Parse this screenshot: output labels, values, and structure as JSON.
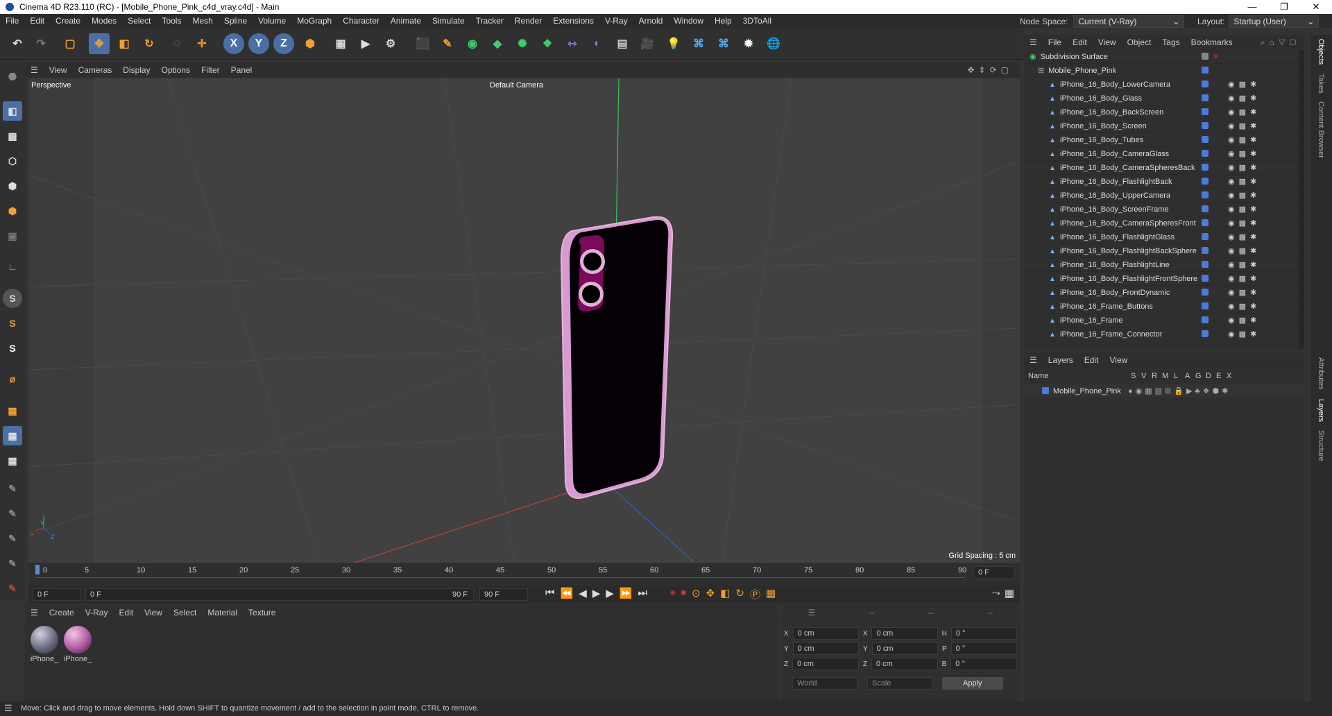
{
  "window": {
    "title": "Cinema 4D R23.110 (RC) - [Mobile_Phone_Pink_c4d_vray.c4d] - Main",
    "controls": [
      "—",
      "❐",
      "✕"
    ]
  },
  "menubar": {
    "items": [
      "File",
      "Edit",
      "Create",
      "Modes",
      "Select",
      "Tools",
      "Mesh",
      "Spline",
      "Volume",
      "MoGraph",
      "Character",
      "Animate",
      "Simulate",
      "Tracker",
      "Render",
      "Extensions",
      "V-Ray",
      "Arnold",
      "Window",
      "Help",
      "3DToAll"
    ],
    "node_space_label": "Node Space:",
    "node_space_value": "Current (V-Ray)",
    "layout_label": "Layout:",
    "layout_value": "Startup (User)"
  },
  "viewport": {
    "menu": [
      "View",
      "Cameras",
      "Display",
      "Options",
      "Filter",
      "Panel"
    ],
    "label": "Perspective",
    "camera": "Default Camera",
    "grid_spacing": "Grid Spacing : 5 cm",
    "axis": {
      "x": "X",
      "y": "Y",
      "z": "Z"
    }
  },
  "timeline": {
    "ticks": [
      "0",
      "5",
      "10",
      "15",
      "20",
      "25",
      "30",
      "35",
      "40",
      "45",
      "50",
      "55",
      "60",
      "65",
      "70",
      "75",
      "80",
      "85",
      "90"
    ],
    "end_frame": "0 F",
    "current_frame": "0 F",
    "range_start": "0 F",
    "range_end": "90 F",
    "max_frame": "90 F"
  },
  "materials": {
    "menu": [
      "Create",
      "V-Ray",
      "Edit",
      "View",
      "Select",
      "Material",
      "Texture"
    ],
    "items": [
      {
        "name": "iPhone_",
        "color": "#8a8aa0"
      },
      {
        "name": "iPhone_",
        "color": "#c06fb0"
      }
    ]
  },
  "coords": {
    "headers": [
      "--",
      "--",
      "--"
    ],
    "rows": [
      {
        "a": "X",
        "av": "0 cm",
        "b": "X",
        "bv": "0 cm",
        "c": "H",
        "cv": "0 °"
      },
      {
        "a": "Y",
        "av": "0 cm",
        "b": "Y",
        "bv": "0 cm",
        "c": "P",
        "cv": "0 °"
      },
      {
        "a": "Z",
        "av": "0 cm",
        "b": "Z",
        "bv": "0 cm",
        "c": "B",
        "cv": "0 °"
      }
    ],
    "mode": "World",
    "scale": "Scale",
    "apply": "Apply"
  },
  "objects": {
    "menu": [
      "File",
      "Edit",
      "View",
      "Object",
      "Tags",
      "Bookmarks"
    ],
    "root": "Subdivision Surface",
    "group": "Mobile_Phone_Pink",
    "items": [
      "iPhone_16_Body_LowerCamera",
      "iPhone_16_Body_Glass",
      "iPhone_16_Body_BackScreen",
      "iPhone_16_Body_Screen",
      "iPhone_16_Body_Tubes",
      "iPhone_16_Body_CameraGlass",
      "iPhone_16_Body_CameraSpheresBack",
      "iPhone_16_Body_FlashlightBack",
      "iPhone_16_Body_UpperCamera",
      "iPhone_16_Body_ScreenFrame",
      "iPhone_16_Body_CameraSpheresFront",
      "iPhone_16_Body_FlashlightGlass",
      "iPhone_16_Body_FlashlightBackSphere",
      "iPhone_16_Body_FlashlightLine",
      "iPhone_16_Body_FlashlightFrontSphere",
      "iPhone_16_Body_FrontDynamic",
      "iPhone_16_Frame_Buttons",
      "iPhone_16_Frame",
      "iPhone_16_Frame_Connector"
    ]
  },
  "layers": {
    "menu": [
      "Layers",
      "Edit",
      "View"
    ],
    "columns": [
      "Name",
      "S",
      "V",
      "R",
      "M",
      "L",
      "A",
      "G",
      "D",
      "E",
      "X"
    ],
    "items": [
      {
        "name": "Mobile_Phone_Pink"
      }
    ]
  },
  "sidetabs": [
    "Objects",
    "Takes",
    "Content Browser",
    "Attributes",
    "Layers",
    "Structure"
  ],
  "status": "Move: Click and drag to move elements. Hold down SHIFT to quantize movement / add to the selection in point mode, CTRL to remove."
}
